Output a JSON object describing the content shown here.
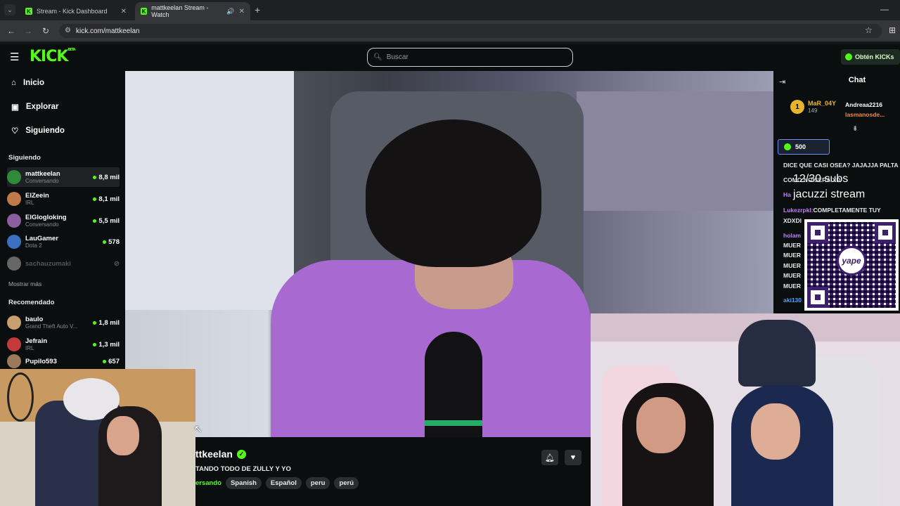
{
  "browser": {
    "tabs": [
      {
        "title": "Stream - Kick Dashboard",
        "close": "✕"
      },
      {
        "title": "mattkeelan Stream - Watch",
        "close": "✕"
      }
    ],
    "new_tab": "+",
    "url": "kick.com/mattkeelan"
  },
  "header": {
    "logo": "KICK",
    "logo_badge": "BETA",
    "search_placeholder": "Buscar",
    "get_kicks": "Obtén KICKs"
  },
  "sidebar": {
    "nav": [
      {
        "label": "Inicio",
        "icon": "home-icon"
      },
      {
        "label": "Explorar",
        "icon": "compass-icon"
      },
      {
        "label": "Siguiendo",
        "icon": "heart-icon"
      }
    ],
    "following_title": "Siguiendo",
    "following": [
      {
        "name": "mattkeelan",
        "sub": "Conversando",
        "viewers": "8,8 mil",
        "color": "#2f8a3a"
      },
      {
        "name": "ElZeein",
        "sub": "IRL",
        "viewers": "8,1 mil",
        "color": "#c07a4a"
      },
      {
        "name": "ElGlogloking",
        "sub": "Conversando",
        "viewers": "5,5 mil",
        "color": "#8a5fa0"
      },
      {
        "name": "LauGamer",
        "sub": "Dota 2",
        "viewers": "578",
        "color": "#3a6fc2"
      },
      {
        "name": "sachauzumaki",
        "sub": "",
        "viewers": "",
        "color": "#666666"
      }
    ],
    "show_more": "Mostrar más",
    "recommended_title": "Recomendado",
    "recommended": [
      {
        "name": "baulo",
        "sub": "Grand Theft Auto V...",
        "viewers": "1,8 mil",
        "color": "#c8a070"
      },
      {
        "name": "Jefrain",
        "sub": "IRL",
        "viewers": "1,3 mil",
        "color": "#c23a3a"
      },
      {
        "name": "Pupilo593",
        "sub": "",
        "viewers": "657",
        "color": "#9a7a5a"
      }
    ]
  },
  "stream": {
    "channel": "ttkeelan",
    "title": "TANDO TODO DE ZULLY Y YO",
    "category": "ersando",
    "tags": [
      "Spanish",
      "Español",
      "peru",
      "perú"
    ]
  },
  "overlay": {
    "line1": "12/30 subs",
    "line2": "jacuzzi stream",
    "qr_logo": "yape"
  },
  "chat": {
    "title": "Chat",
    "gifter": {
      "rank": "1",
      "name": "MaR_04Y",
      "count": "149"
    },
    "gifter2": [
      "Andreaa2216",
      "lasmanosde..."
    ],
    "kicks_badge": "500",
    "messages": [
      {
        "user": "",
        "text": "DICE QUE CASI OSEA? JAJAJJA PALTA"
      },
      {
        "user": "",
        "text": "COMO NO SERA XD"
      },
      {
        "user": "Ha",
        "text": ""
      },
      {
        "user": "Lukezrpkl:",
        "text": "COMPLETAMENTE TUY"
      },
      {
        "user": "",
        "text": "XDXDI"
      },
      {
        "user": "holam",
        "text": ""
      },
      {
        "user": "",
        "text": "MUER"
      },
      {
        "user": "",
        "text": "MUER"
      },
      {
        "user": "",
        "text": "MUER"
      },
      {
        "user": "",
        "text": "MUER"
      },
      {
        "user": "",
        "text": "MUER"
      },
      {
        "user": "aki130",
        "text": ""
      }
    ]
  },
  "colors": {
    "brand": "#53fc18",
    "background": "#0b0e0f"
  }
}
